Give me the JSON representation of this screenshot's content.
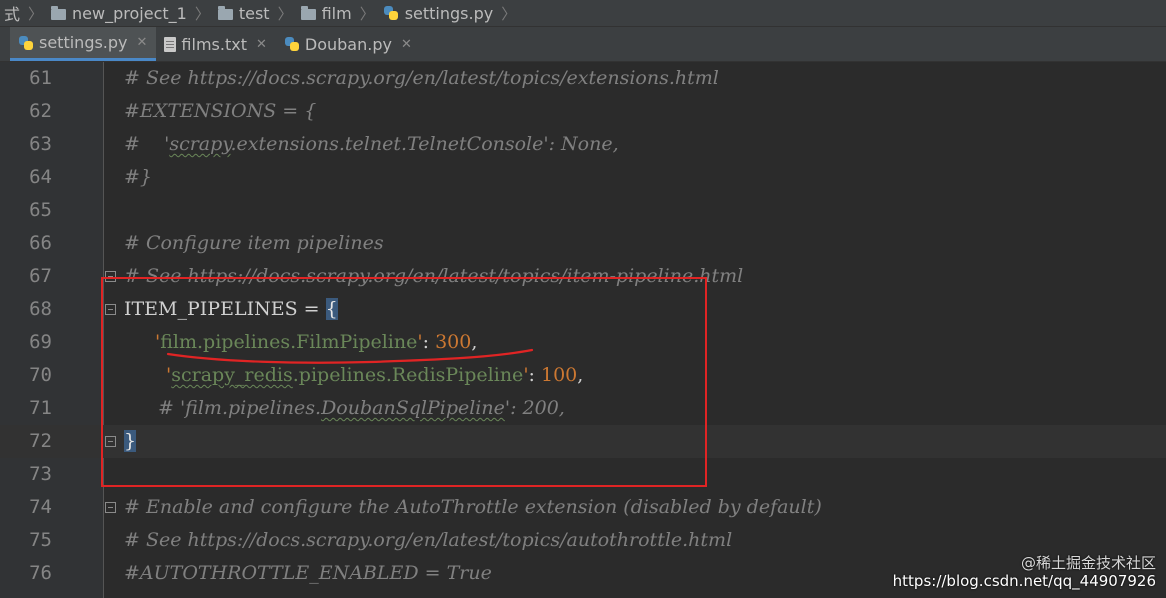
{
  "breadcrumbs": [
    {
      "label": "式",
      "icon": "none"
    },
    {
      "label": "new_project_1",
      "icon": "folder-icon"
    },
    {
      "label": "test",
      "icon": "folder-icon"
    },
    {
      "label": "film",
      "icon": "folder-icon"
    },
    {
      "label": "settings.py",
      "icon": "python-file-icon"
    }
  ],
  "tabs": [
    {
      "label": "settings.py",
      "icon": "python-file-icon",
      "active": true
    },
    {
      "label": "films.txt",
      "icon": "text-file-icon",
      "active": false
    },
    {
      "label": "Douban.py",
      "icon": "python-file-icon",
      "active": false
    }
  ],
  "lines": [
    {
      "num": "61",
      "text": "# See https://docs.scrapy.org/en/latest/topics/extensions.html"
    },
    {
      "num": "62",
      "text": "#EXTENSIONS = {"
    },
    {
      "num": "63",
      "text": "#    'scrapy.extensions.telnet.TelnetConsole': None,"
    },
    {
      "num": "64",
      "text": "#}"
    },
    {
      "num": "65",
      "text": ""
    },
    {
      "num": "66",
      "text": "# Configure item pipelines"
    },
    {
      "num": "67",
      "text": "# See https://docs.scrapy.org/en/latest/topics/item-pipeline.html"
    },
    {
      "num": "68",
      "text": "ITEM_PIPELINES = {"
    },
    {
      "num": "69",
      "text": "   'film.pipelines.FilmPipeline': 300,"
    },
    {
      "num": "70",
      "text": "    'scrapy_redis.pipelines.RedisPipeline': 100,"
    },
    {
      "num": "71",
      "text": "   # 'film.pipelines.DoubanSqlPipeline': 200,"
    },
    {
      "num": "72",
      "text": "}"
    },
    {
      "num": "73",
      "text": ""
    },
    {
      "num": "74",
      "text": "# Enable and configure the AutoThrottle extension (disabled by default)"
    },
    {
      "num": "75",
      "text": "# See https://docs.scrapy.org/en/latest/topics/autothrottle.html"
    },
    {
      "num": "76",
      "text": "#AUTOTHROTTLE_ENABLED = True"
    }
  ],
  "code_tokens": {
    "l68": {
      "name": "ITEM_PIPELINES",
      "eq": " = ",
      "brace": "{"
    },
    "l69": {
      "q1": "'",
      "str": "film.pipelines.FilmPipeline",
      "q2": "'",
      "colon": ": ",
      "num": "300",
      "comma": ","
    },
    "l70": {
      "q1": "'",
      "squig": "scrapy_redis",
      "str": ".pipelines.RedisPipeline",
      "q2": "'",
      "colon": ": ",
      "num": "100",
      "comma": ","
    },
    "l71": {
      "pre": "# 'film.pipelines.",
      "squig": "DoubanSqlPipeline",
      "post": "': 200,"
    },
    "l72": {
      "brace": "}"
    },
    "l63": {
      "pre": "#    '",
      "squig": "scrapy",
      "post": ".extensions.telnet.TelnetConsole': None,"
    }
  },
  "watermark": {
    "line1": "@稀土掘金技术社区",
    "line2": "https://blog.csdn.net/qq_44907926"
  },
  "colors": {
    "background": "#2b2b2b",
    "comment": "#808080",
    "string": "#6a8759",
    "number": "#6897bb",
    "annotation_red": "#e02424"
  }
}
